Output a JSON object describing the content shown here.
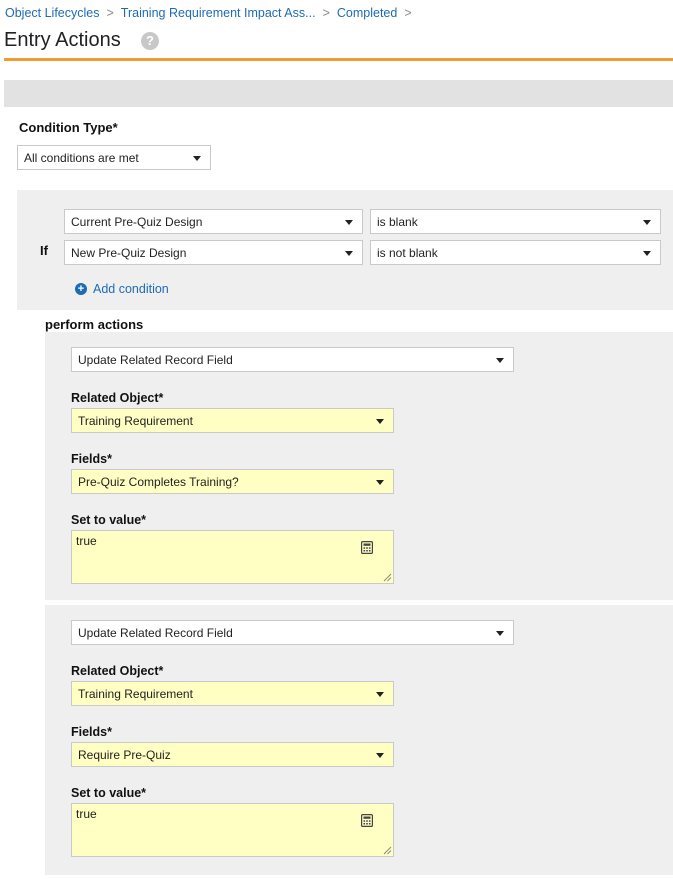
{
  "breadcrumb": {
    "items": [
      "Object Lifecycles",
      "Training Requirement Impact Ass...",
      "Completed"
    ],
    "separator": ">"
  },
  "page": {
    "title": "Entry Actions",
    "help_symbol": "?"
  },
  "condition_type": {
    "label": "Condition Type*",
    "value": "All conditions are met"
  },
  "conditions": {
    "if_label": "If",
    "rows": [
      {
        "field": "Current Pre-Quiz Design",
        "operator": "is blank"
      },
      {
        "field": "New Pre-Quiz Design",
        "operator": "is not blank"
      }
    ],
    "add_label": "Add condition"
  },
  "actions": {
    "label": "perform actions",
    "items": [
      {
        "action_type": "Update Related Record Field",
        "related_object_label": "Related Object*",
        "related_object": "Training Requirement",
        "fields_label": "Fields*",
        "field": "Pre-Quiz Completes Training?",
        "set_value_label": "Set to value*",
        "value": "true"
      },
      {
        "action_type": "Update Related Record Field",
        "related_object_label": "Related Object*",
        "related_object": "Training Requirement",
        "fields_label": "Fields*",
        "field": "Require Pre-Quiz",
        "set_value_label": "Set to value*",
        "value": "true"
      }
    ]
  },
  "colors": {
    "accent": "#f39a32",
    "link": "#1f6bb3",
    "highlight": "#ffffc4",
    "panel": "#efefef"
  }
}
